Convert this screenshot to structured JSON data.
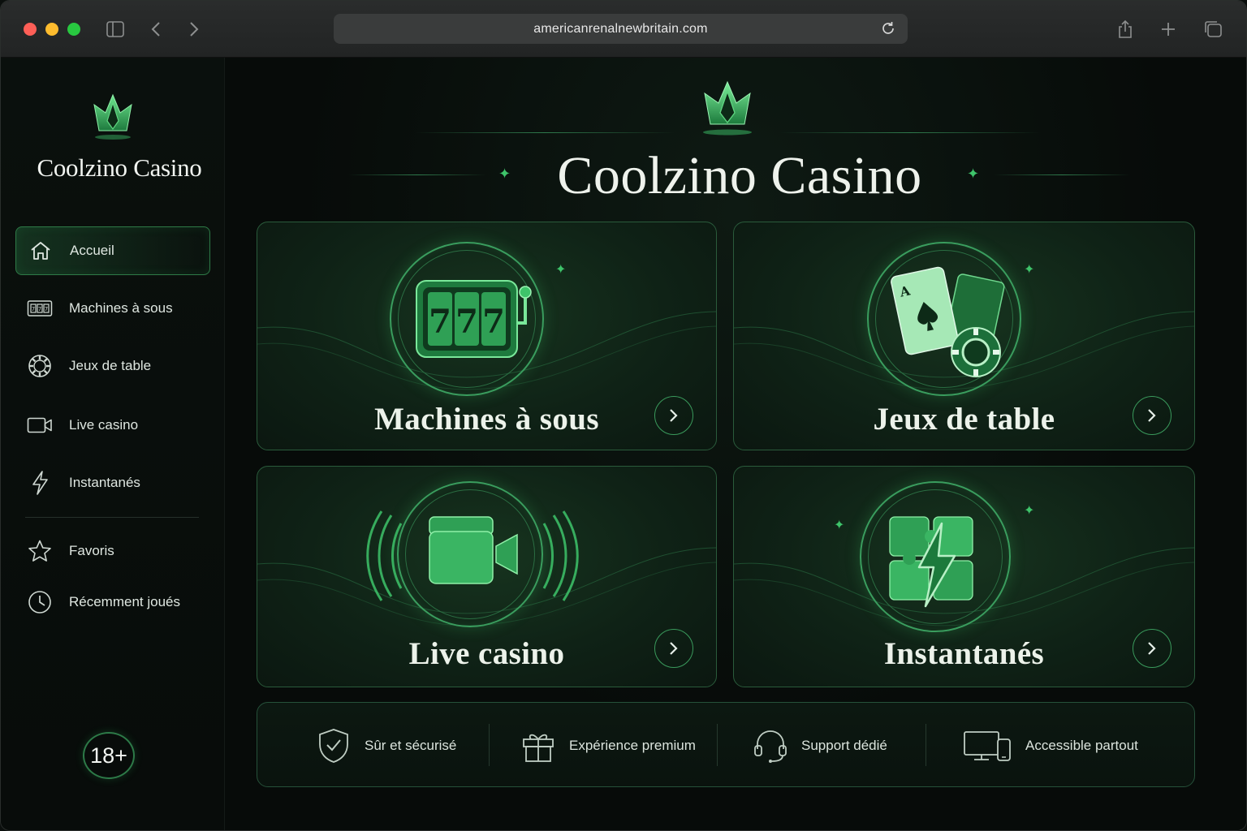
{
  "browser": {
    "url": "americanrenalnewbritain.com"
  },
  "sidebar": {
    "brand": "Coolzino Casino",
    "items": [
      {
        "label": "Accueil",
        "icon": "home-icon"
      },
      {
        "label": "Machines à sous",
        "icon": "slot-machine-icon"
      },
      {
        "label": "Jeux de table",
        "icon": "poker-chip-icon"
      },
      {
        "label": "Live casino",
        "icon": "video-camera-icon"
      },
      {
        "label": "Instantanés",
        "icon": "lightning-icon"
      },
      {
        "label": "Favoris",
        "icon": "star-icon"
      },
      {
        "label": "Récemment joués",
        "icon": "clock-icon"
      }
    ],
    "age_badge": "18+"
  },
  "hero": {
    "title": "Coolzino Casino"
  },
  "cards": [
    {
      "title": "Machines à sous",
      "icon": "slot-machine-icon"
    },
    {
      "title": "Jeux de table",
      "icon": "playing-cards-icon"
    },
    {
      "title": "Live casino",
      "icon": "video-camera-icon"
    },
    {
      "title": "Instantanés",
      "icon": "puzzle-lightning-icon"
    }
  ],
  "features": [
    {
      "label": "Sûr et sécurisé",
      "icon": "shield-check-icon"
    },
    {
      "label": "Expérience premium",
      "icon": "gift-icon"
    },
    {
      "label": "Support dédié",
      "icon": "headset-icon"
    },
    {
      "label": "Accessible partout",
      "icon": "devices-icon"
    }
  ],
  "colors": {
    "accent": "#3ec46a",
    "background": "#070b09",
    "card_border": "#2a5b3b"
  }
}
